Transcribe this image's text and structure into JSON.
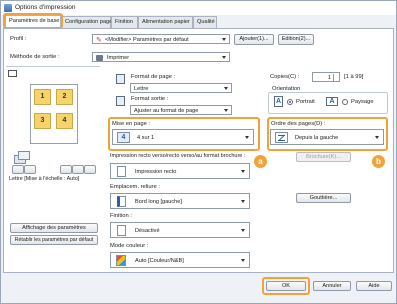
{
  "window": {
    "title": "Options d'impression"
  },
  "tabs": [
    "Paramètres de base",
    "Configuration page",
    "Finition",
    "Alimentation papier",
    "Qualité"
  ],
  "profile": {
    "label": "Profil :",
    "value": "<Modifier> Paramètres par défaut",
    "add_button": "Ajouter(1)...",
    "edit_button": "Edition(2)..."
  },
  "output_method": {
    "label": "Méthode de sortie :",
    "value": "Imprimer"
  },
  "page_format": {
    "label": "Format de page :",
    "value": "Lettre"
  },
  "output_format": {
    "label": "Format sortie :",
    "value": "Ajuster au format de page"
  },
  "copies": {
    "label": "Copies(C) :",
    "value": "1",
    "range": "[1 à 99]"
  },
  "orientation": {
    "label": "Orientation",
    "portrait_label": "Portrait",
    "landscape_label": "Paysage",
    "portrait_glyph": "A",
    "landscape_glyph": "A"
  },
  "layout": {
    "label": "Mise en page :",
    "value": "4 sur 1",
    "badge": "a",
    "icon_number": "4"
  },
  "page_order": {
    "label": "Ordre des pages(D) :",
    "value": "Depuis la gauche",
    "badge": "b"
  },
  "duplex": {
    "label": "Impression recto verso/recto verso/au format brochure :",
    "value": "Impression recto",
    "booklet_button": "Brochure(K)..."
  },
  "binding": {
    "label": "Emplacem. reliure :",
    "value": "Bord long [gauche]",
    "gutter_button": "Gouttière..."
  },
  "finishing": {
    "label": "Finition :",
    "value": "Désactivé"
  },
  "color_mode": {
    "label": "Mode couleur :",
    "value": "Auto [Couleur/N&B]"
  },
  "preview": {
    "cells": [
      "1",
      "2",
      "3",
      "4"
    ],
    "caption": "Lettre [Mise à l'échelle : Auto]"
  },
  "left_buttons": {
    "show_settings": "Affichage des paramètres",
    "restore_defaults": "Rétablir les paramètres par défaut"
  },
  "footer": {
    "ok": "OK",
    "cancel": "Annuler",
    "help": "Aide"
  },
  "colors": {
    "accent_highlight": "#f0a33a"
  }
}
